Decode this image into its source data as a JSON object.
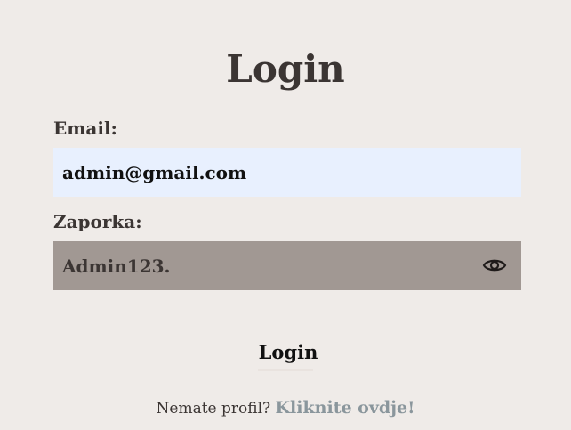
{
  "title": "Login",
  "email": {
    "label": "Email:",
    "value": "admin@gmail.com"
  },
  "password": {
    "label": "Zaporka:",
    "value": "Admin123.",
    "toggle_icon": "eye-icon"
  },
  "submit_label": "Login",
  "footer": {
    "prompt": "Nemate profil?",
    "link_text": "Kliknite ovdje!"
  },
  "colors": {
    "background": "#efebe8",
    "email_field_bg": "#e8f0fe",
    "password_field_bg": "#a19893",
    "link": "#8a969c",
    "text": "#3b3533"
  }
}
